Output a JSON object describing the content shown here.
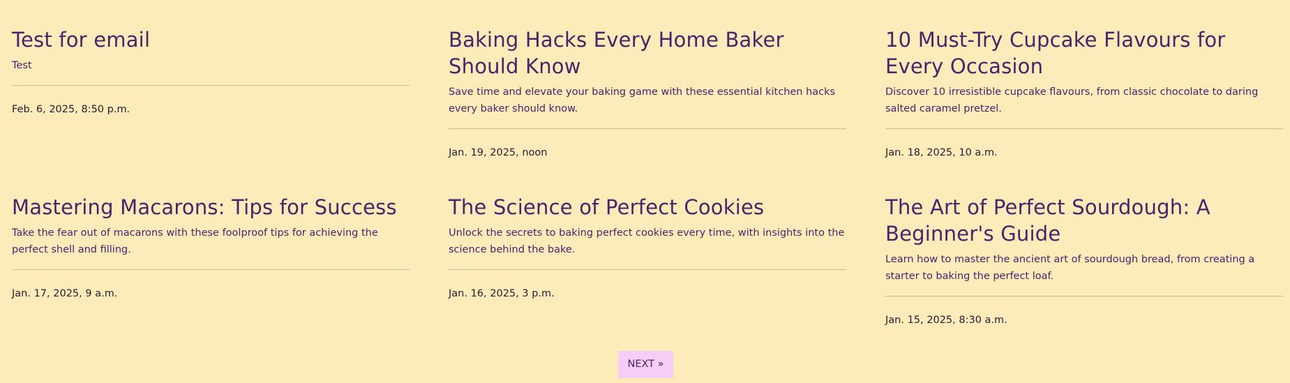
{
  "posts": [
    {
      "title": "Test for email",
      "excerpt": "Test",
      "date": "Feb. 6, 2025, 8:50 p.m."
    },
    {
      "title": "Baking Hacks Every Home Baker Should Know",
      "excerpt": "Save time and elevate your baking game with these essential kitchen hacks every baker should know.",
      "date": "Jan. 19, 2025, noon"
    },
    {
      "title": "10 Must-Try Cupcake Flavours for Every Occasion",
      "excerpt": "Discover 10 irresistible cupcake flavours, from classic chocolate to daring salted caramel pretzel.",
      "date": "Jan. 18, 2025, 10 a.m."
    },
    {
      "title": "Mastering Macarons: Tips for Success",
      "excerpt": "Take the fear out of macarons with these foolproof tips for achieving the perfect shell and filling.",
      "date": "Jan. 17, 2025, 9 a.m."
    },
    {
      "title": "The Science of Perfect Cookies",
      "excerpt": "Unlock the secrets to baking perfect cookies every time, with insights into the science behind the bake.",
      "date": "Jan. 16, 2025, 3 p.m."
    },
    {
      "title": "The Art of Perfect Sourdough: A Beginner's Guide",
      "excerpt": "Learn how to master the ancient art of sourdough bread, from creating a starter to baking the perfect loaf.",
      "date": "Jan. 15, 2025, 8:30 a.m."
    }
  ],
  "pagination": {
    "next_label": "NEXT »"
  },
  "colors": {
    "background": "#fdebb9",
    "text": "#4a2368",
    "button_bg": "#f6cdf4",
    "divider": "#c9b99a"
  }
}
